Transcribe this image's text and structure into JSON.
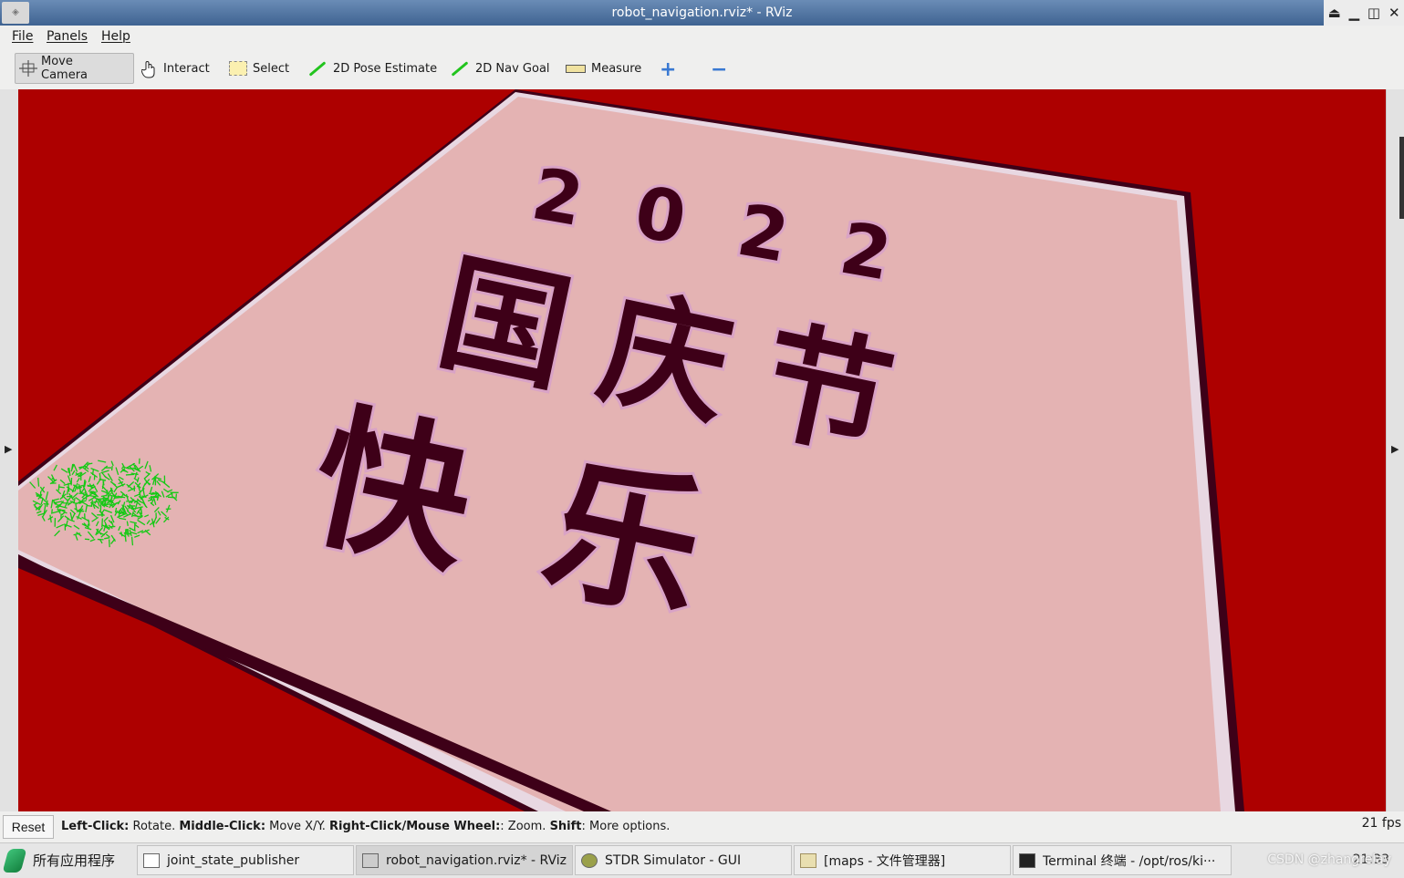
{
  "window": {
    "title": "robot_navigation.rviz* - RViz",
    "controls": [
      "⏏",
      "▁",
      "◫",
      "✕"
    ]
  },
  "menu": [
    "File",
    "Panels",
    "Help"
  ],
  "toolbar": {
    "tools": [
      {
        "label": "Move Camera",
        "icon": "move-camera-icon",
        "active": true
      },
      {
        "label": "Interact",
        "icon": "hand-icon"
      },
      {
        "label": "Select",
        "icon": "select-box-icon"
      },
      {
        "label": "2D Pose Estimate",
        "icon": "green-arrow-icon"
      },
      {
        "label": "2D Nav Goal",
        "icon": "green-arrow-icon"
      },
      {
        "label": "Measure",
        "icon": "ruler-icon"
      }
    ],
    "add_tool": "+",
    "remove_tool": "−"
  },
  "viewport": {
    "map_text_year": "2022",
    "map_text_line1": "国庆节",
    "map_text_line2": "快乐",
    "colors": {
      "background": "#ad0000",
      "map": "#e4b3b3",
      "glyph": "#3e0018",
      "particles": "#15c915"
    }
  },
  "status": {
    "reset": "Reset",
    "hint_parts": [
      {
        "b": "Left-Click:",
        "t": " Rotate. "
      },
      {
        "b": "Middle-Click:",
        "t": " Move X/Y. "
      },
      {
        "b": "Right-Click/Mouse Wheel:",
        "t": ": Zoom. "
      },
      {
        "b": "Shift",
        "t": ": More options."
      }
    ],
    "fps": "21 fps"
  },
  "taskbar": {
    "start": "所有应用程序",
    "tasks": [
      {
        "label": "joint_state_publisher",
        "icon": "window-icon"
      },
      {
        "label": "robot_navigation.rviz* - RViz",
        "icon": "rviz-icon",
        "active": true
      },
      {
        "label": "STDR Simulator - GUI",
        "icon": "stdr-icon"
      },
      {
        "label": "[maps - 文件管理器]",
        "icon": "folder-icon"
      },
      {
        "label": "Terminal 终端 - /opt/ros/ki···",
        "icon": "terminal-icon"
      }
    ],
    "clock": "21:33",
    "watermark": "CSDN @zhangrelay"
  }
}
